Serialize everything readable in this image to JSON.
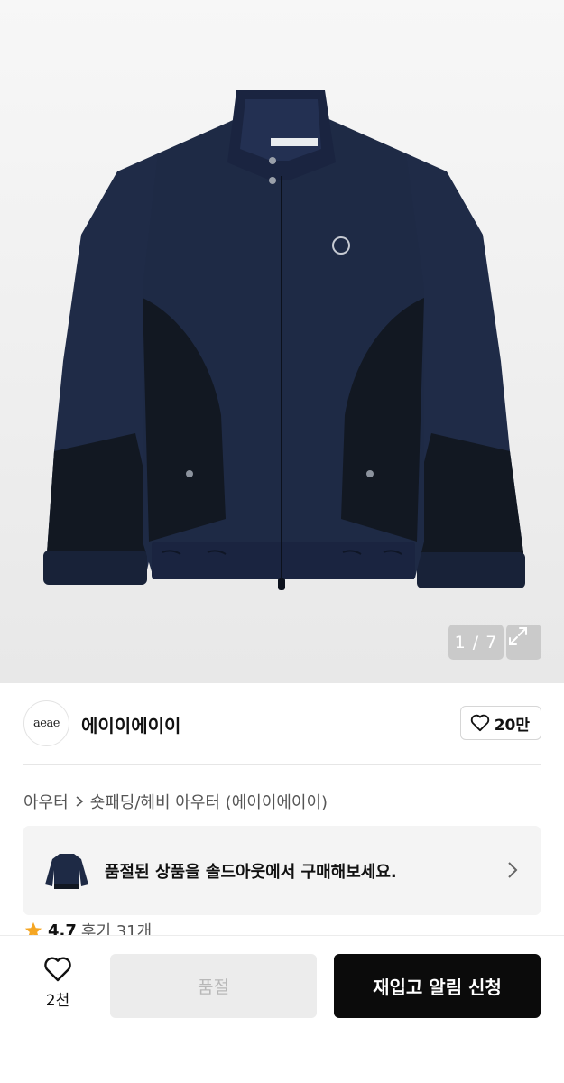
{
  "gallery": {
    "pager": "1 / 7",
    "image_icon": "jacket-image",
    "expand_icon": "expand-icon"
  },
  "brand": {
    "logo_text": "aeae",
    "name": "에이이에이이",
    "like_count": "20만"
  },
  "breadcrumb": {
    "category": "아우터",
    "subcategory": "숏패딩/헤비 아우터 (에이이에이이)"
  },
  "soldout_banner": {
    "text": "품절된 상품을 솔드아웃에서 구매해보세요."
  },
  "rating": {
    "score": "4.7",
    "reviews": "후기 31개"
  },
  "bottom_bar": {
    "wish_count": "2천",
    "soldout_label": "품절",
    "restock_label": "재입고 알림 신청"
  },
  "colors": {
    "primary_button": "#0b0b0b",
    "disabled_button": "#ececec",
    "star": "#f5a623",
    "jacket_navy": "#1e2a45",
    "jacket_dark": "#121822"
  }
}
